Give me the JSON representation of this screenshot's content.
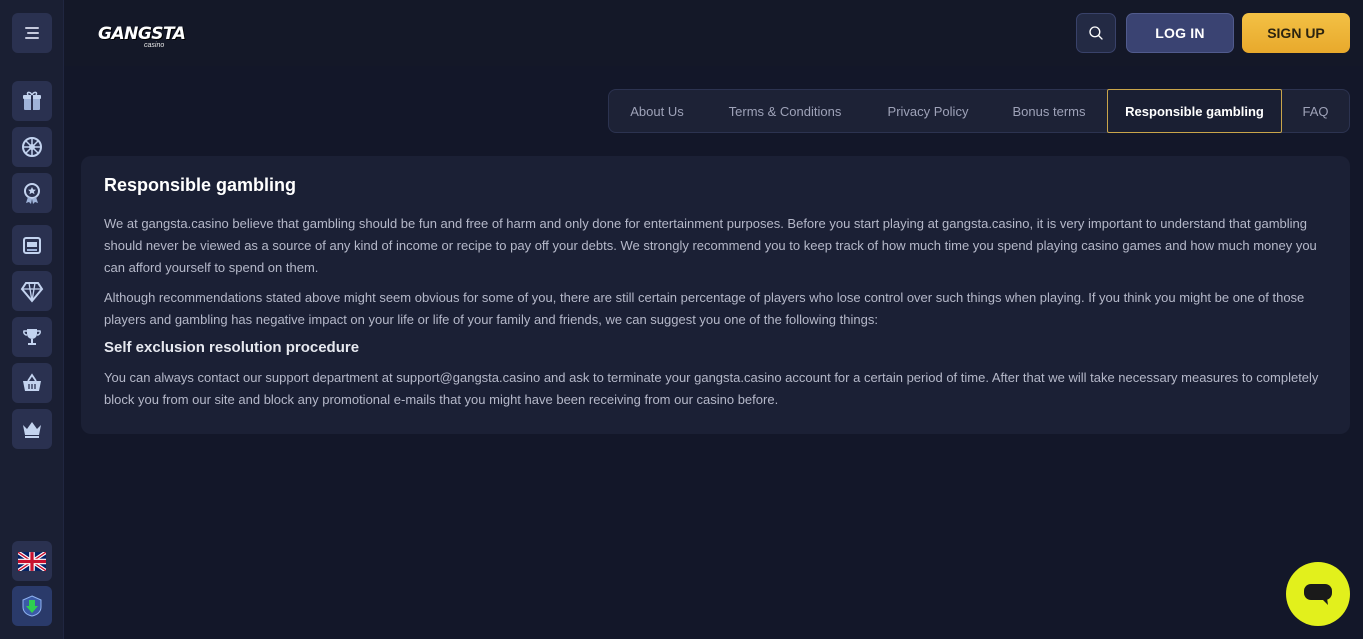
{
  "header": {
    "logo_text": "GANGSTA",
    "logo_sub": "casino",
    "login_label": "LOG IN",
    "signup_label": "SIGN UP"
  },
  "sidebar": {
    "items": [
      {
        "icon": "gift-icon"
      },
      {
        "icon": "wheel-icon"
      },
      {
        "icon": "award-icon"
      },
      {
        "icon": "slot-machine-icon"
      },
      {
        "icon": "diamond-icon"
      },
      {
        "icon": "trophy-icon"
      },
      {
        "icon": "basket-icon"
      },
      {
        "icon": "crown-icon"
      }
    ],
    "language_icon": "uk-flag-icon",
    "download_icon": "download-icon"
  },
  "tabs": [
    {
      "label": "About Us",
      "active": false
    },
    {
      "label": "Terms & Conditions",
      "active": false
    },
    {
      "label": "Privacy Policy",
      "active": false
    },
    {
      "label": "Bonus terms",
      "active": false
    },
    {
      "label": "Responsible gambling",
      "active": true
    },
    {
      "label": "FAQ",
      "active": false
    }
  ],
  "content": {
    "title": "Responsible gambling",
    "paragraph_1": "We at gangsta.casino believe that gambling should be fun and free of harm and only done for entertainment purposes. Before you start playing at gangsta.casino, it is very important to understand that gambling should never be viewed as a source of any kind of income or recipe to pay off your debts. We strongly recommend you to keep track of how much time you spend playing casino games and how much money you can afford yourself to spend on them.",
    "paragraph_2": "Although recommendations stated above might seem obvious for some of you, there are still certain percentage of players who lose control over such things when playing. If you think you might be one of those players and gambling has negative impact on your life or life of your family and friends, we can suggest you one of the following things:",
    "subtitle": "Self exclusion resolution procedure",
    "paragraph_3": "You can always contact our support department at support@gangsta.casino and ask to terminate your gangsta.casino account for a certain period of time. After that we will take necessary measures to completely block you from our site and block any promotional e-mails that you might have been receiving from our casino before."
  },
  "colors": {
    "background": "#131729",
    "accent_gold": "#e8a92c",
    "chat_yellow": "#e2f01c"
  }
}
